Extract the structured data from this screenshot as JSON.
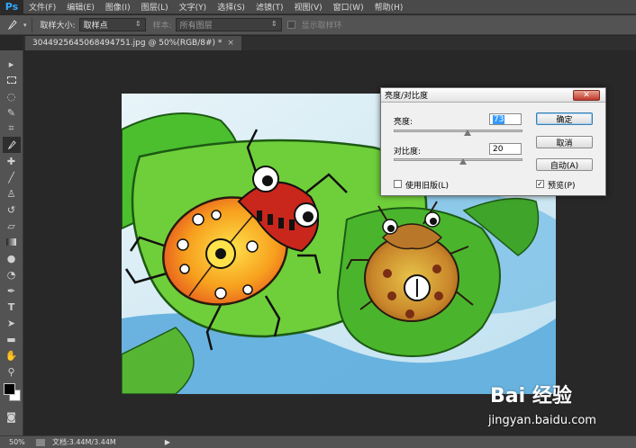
{
  "app": {
    "logo": "Ps"
  },
  "menubar": {
    "items": [
      "文件(F)",
      "编辑(E)",
      "图像(I)",
      "图层(L)",
      "文字(Y)",
      "选择(S)",
      "滤镜(T)",
      "视图(V)",
      "窗口(W)",
      "帮助(H)"
    ]
  },
  "options": {
    "sample_size_label": "取样大小:",
    "sample_size_value": "取样点",
    "sample_label": "样本:",
    "sample_value": "所有图层",
    "show_ring_label": "显示取样环"
  },
  "document": {
    "tab_title": "3044925645068494751.jpg @ 50%(RGB/8#) *",
    "close_glyph": "×"
  },
  "status": {
    "zoom": "50%",
    "doc_info": "文档:3.44M/3.44M",
    "arrow": "▶"
  },
  "dialog": {
    "title": "亮度/对比度",
    "brightness_label": "亮度:",
    "brightness_value": "73",
    "contrast_label": "对比度:",
    "contrast_value": "20",
    "legacy_label": "使用旧版(L)",
    "legacy_checked": false,
    "preview_label": "预览(P)",
    "preview_checked": true,
    "ok_label": "确定",
    "cancel_label": "取消",
    "auto_label": "自动(A)",
    "brightness_level": 0.574,
    "contrast_level": 0.54
  },
  "watermark": {
    "brand": "Bai 经验",
    "url": "jingyan.baidu.com"
  },
  "colors": {
    "accent": "#31a8ff",
    "foreground": "#000000",
    "background": "#ffffff"
  },
  "tools": [
    "move-icon",
    "marquee-icon",
    "lasso-icon",
    "quick-select-icon",
    "crop-icon",
    "eyedropper-icon",
    "healing-brush-icon",
    "brush-icon",
    "clone-stamp-icon",
    "history-brush-icon",
    "eraser-icon",
    "gradient-icon",
    "blur-icon",
    "dodge-icon",
    "pen-icon",
    "type-icon",
    "path-select-icon",
    "rectangle-icon",
    "hand-icon",
    "zoom-icon"
  ]
}
